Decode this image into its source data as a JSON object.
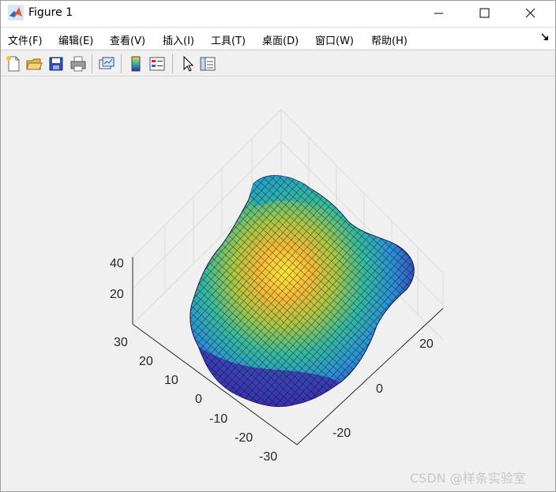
{
  "window": {
    "title": "Figure 1",
    "controls": {
      "minimize": "—",
      "maximize": "☐",
      "close": "✕"
    }
  },
  "menubar": {
    "items": [
      "文件(F)",
      "编辑(E)",
      "查看(V)",
      "插入(I)",
      "工具(T)",
      "桌面(D)",
      "窗口(W)",
      "帮助(H)"
    ],
    "overflow_icon": "dock-arrow-icon"
  },
  "toolbar": {
    "buttons": [
      "new-figure-icon",
      "open-file-icon",
      "save-icon",
      "print-icon",
      "link-plot-icon",
      "colorbar-icon",
      "legend-icon",
      "edit-plot-pointer-icon",
      "property-inspector-icon"
    ]
  },
  "axes": {
    "z_ticks": [
      "40",
      "20"
    ],
    "y_ticks": [
      "30",
      "20",
      "10",
      "0",
      "-10",
      "-20",
      "-30"
    ],
    "x_ticks": [
      "20",
      "0",
      "-20"
    ],
    "grid": true,
    "colormap": "parula",
    "colors": {
      "low": "#3e26a8",
      "mid": "#2ab5aa",
      "high": "#f9d33c",
      "grid": "#dcdcdc",
      "edge": "#000000"
    }
  },
  "watermark": "CSDN @样条实验室"
}
